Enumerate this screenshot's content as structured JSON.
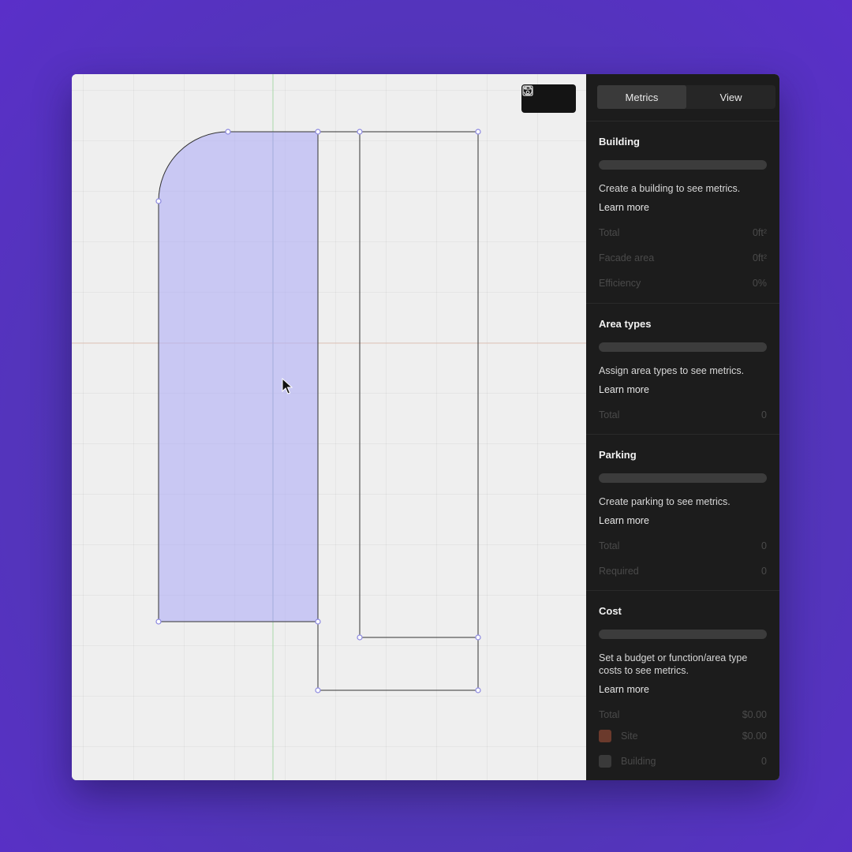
{
  "tabs": [
    {
      "label": "Metrics",
      "active": true
    },
    {
      "label": "View",
      "active": false
    }
  ],
  "toolbar": {
    "save_icon": "save-icon",
    "undo_icon": "undo-icon"
  },
  "sections": {
    "building": {
      "title": "Building",
      "message": "Create a building to see metrics.",
      "learn_more": "Learn more",
      "rows": [
        {
          "label": "Total",
          "value": "0ft²"
        },
        {
          "label": "Facade area",
          "value": "0ft²"
        },
        {
          "label": "Efficiency",
          "value": "0%"
        }
      ]
    },
    "area_types": {
      "title": "Area types",
      "message": "Assign area types to see metrics.",
      "learn_more": "Learn more",
      "rows": [
        {
          "label": "Total",
          "value": "0"
        }
      ]
    },
    "parking": {
      "title": "Parking",
      "message": "Create parking to see metrics.",
      "learn_more": "Learn more",
      "rows": [
        {
          "label": "Total",
          "value": "0"
        },
        {
          "label": "Required",
          "value": "0"
        }
      ]
    },
    "cost": {
      "title": "Cost",
      "message": "Set a budget or function/area type costs to see metrics.",
      "learn_more": "Learn more",
      "rows": [
        {
          "label": "Total",
          "value": "$0.00"
        },
        {
          "label": "Site",
          "value": "$0.00",
          "swatch": "#6b3a2c"
        },
        {
          "label": "Building",
          "value": "0",
          "swatch": "#3a3a3a"
        }
      ]
    }
  },
  "colors": {
    "selection_fill": "#c7c6f2",
    "vertex": "#8b88e0",
    "axis_green": "#a8d8a8",
    "axis_red": "#e0c4b8"
  }
}
